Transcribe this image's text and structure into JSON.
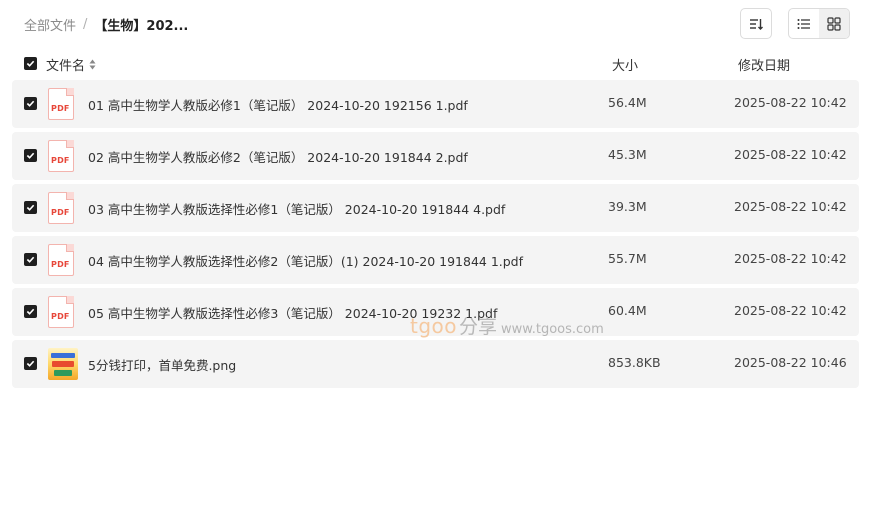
{
  "breadcrumb": {
    "root": "全部文件",
    "separator": "/",
    "current": "【生物】202..."
  },
  "toolbar": {
    "sort_icon": "sort-icon",
    "list_view_icon": "list-view-icon",
    "grid_view_icon": "grid-view-icon",
    "active_view": "grid"
  },
  "header": {
    "name": "文件名",
    "size": "大小",
    "date": "修改日期",
    "all_checked": true
  },
  "files": [
    {
      "name": "01 高中生物学人教版必修1（笔记版） 2024-10-20 192156 1.pdf",
      "size": "56.4M",
      "date": "2025-08-22 10:42",
      "type": "pdf",
      "checked": true
    },
    {
      "name": "02 高中生物学人教版必修2（笔记版） 2024-10-20 191844 2.pdf",
      "size": "45.3M",
      "date": "2025-08-22 10:42",
      "type": "pdf",
      "checked": true
    },
    {
      "name": "03 高中生物学人教版选择性必修1（笔记版） 2024-10-20 191844 4.pdf",
      "size": "39.3M",
      "date": "2025-08-22 10:42",
      "type": "pdf",
      "checked": true
    },
    {
      "name": "04 高中生物学人教版选择性必修2（笔记版）(1) 2024-10-20 191844 1.pdf",
      "size": "55.7M",
      "date": "2025-08-22 10:42",
      "type": "pdf",
      "checked": true
    },
    {
      "name": "05 高中生物学人教版选择性必修3（笔记版） 2024-10-20 19232 1.pdf",
      "size": "60.4M",
      "date": "2025-08-22 10:42",
      "type": "pdf",
      "checked": true
    },
    {
      "name": "5分钱打印，首单免费.png",
      "size": "853.8KB",
      "date": "2025-08-22 10:46",
      "type": "png",
      "checked": true
    }
  ],
  "file_icon_label": "PDF",
  "watermark": {
    "brand": "tgoo",
    "share": "分享",
    "url": "www.tgoos.com"
  },
  "colors": {
    "row_bg": "#f4f4f4",
    "checkbox": "#1f1f1f",
    "pdf_red": "#e7473a"
  }
}
